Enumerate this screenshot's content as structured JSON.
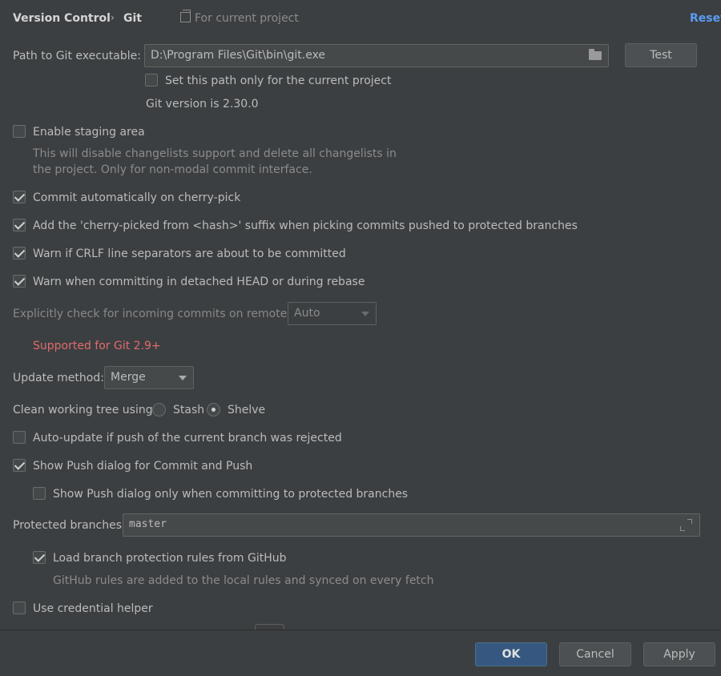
{
  "header": {
    "breadcrumb_parent": "Version Control",
    "breadcrumb_current": "Git",
    "scope": "For current project",
    "reset_label": "Reset"
  },
  "git_path": {
    "label": "Path to Git executable:",
    "value": "D:\\Program Files\\Git\\bin\\git.exe",
    "test_label": "Test",
    "project_only_label": "Set this path only for the current project",
    "project_only_checked": false,
    "version_text": "Git version is 2.30.0"
  },
  "staging": {
    "label": "Enable staging area",
    "checked": false,
    "hint_line1": "This will disable changelists support and delete all changelists in",
    "hint_line2": "the project. Only for non-modal commit interface."
  },
  "options": [
    {
      "label": "Commit automatically on cherry-pick",
      "checked": true
    },
    {
      "label": "Add the 'cherry-picked from <hash>' suffix when picking commits pushed to protected branches",
      "checked": true
    },
    {
      "label": "Warn if CRLF line separators are about to be committed",
      "checked": true
    },
    {
      "label": "Warn when committing in detached HEAD or during rebase",
      "checked": true
    }
  ],
  "incoming": {
    "label": "Explicitly check for incoming commits on remotes:",
    "value": "Auto",
    "warning": "Supported for Git 2.9+"
  },
  "update_method": {
    "label": "Update method:",
    "value": "Merge"
  },
  "clean_tree": {
    "label": "Clean working tree using:",
    "options": [
      "Stash",
      "Shelve"
    ],
    "selected": "Shelve"
  },
  "push": {
    "auto_update_label": "Auto-update if push of the current branch was rejected",
    "auto_update_checked": false,
    "show_push_label": "Show Push dialog for Commit and Push",
    "show_push_checked": true,
    "protected_only_label": "Show Push dialog only when committing to protected branches",
    "protected_only_checked": false
  },
  "protected": {
    "label": "Protected branches:",
    "value": "master",
    "github_label": "Load branch protection rules from GitHub",
    "github_checked": true,
    "github_hint": "GitHub rules are added to the local rules and synced on every fetch"
  },
  "credential": {
    "label": "Use credential helper",
    "checked": false
  },
  "footer": {
    "ok_label": "OK",
    "cancel_label": "Cancel",
    "apply_label": "Apply"
  }
}
